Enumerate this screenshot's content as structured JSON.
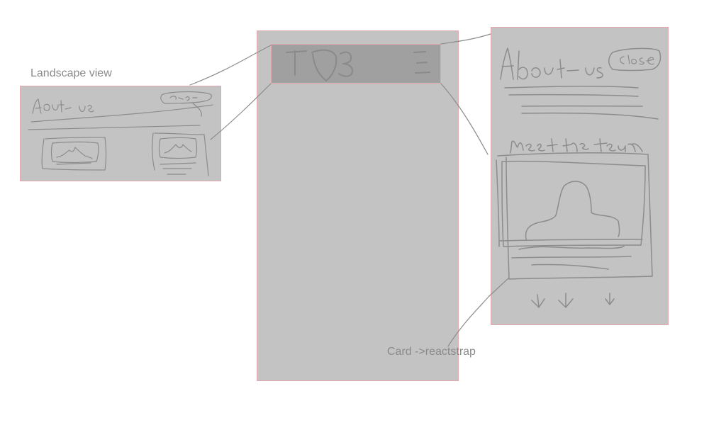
{
  "labels": {
    "landscape_view": "Landscape view",
    "card_note": "Card ->reactstrap"
  },
  "colors": {
    "background": "#ffffff",
    "frame_fill": "#c3c3c3",
    "frame_border": "#e3a9b0",
    "navbar_fill": "#a0a0a0",
    "ink": "#8c8c8c"
  },
  "icons": {
    "hamburger": "hamburger-menu-icon",
    "down_arrow": "down-arrow-icon",
    "image_placeholder": "image-placeholder-icon"
  }
}
